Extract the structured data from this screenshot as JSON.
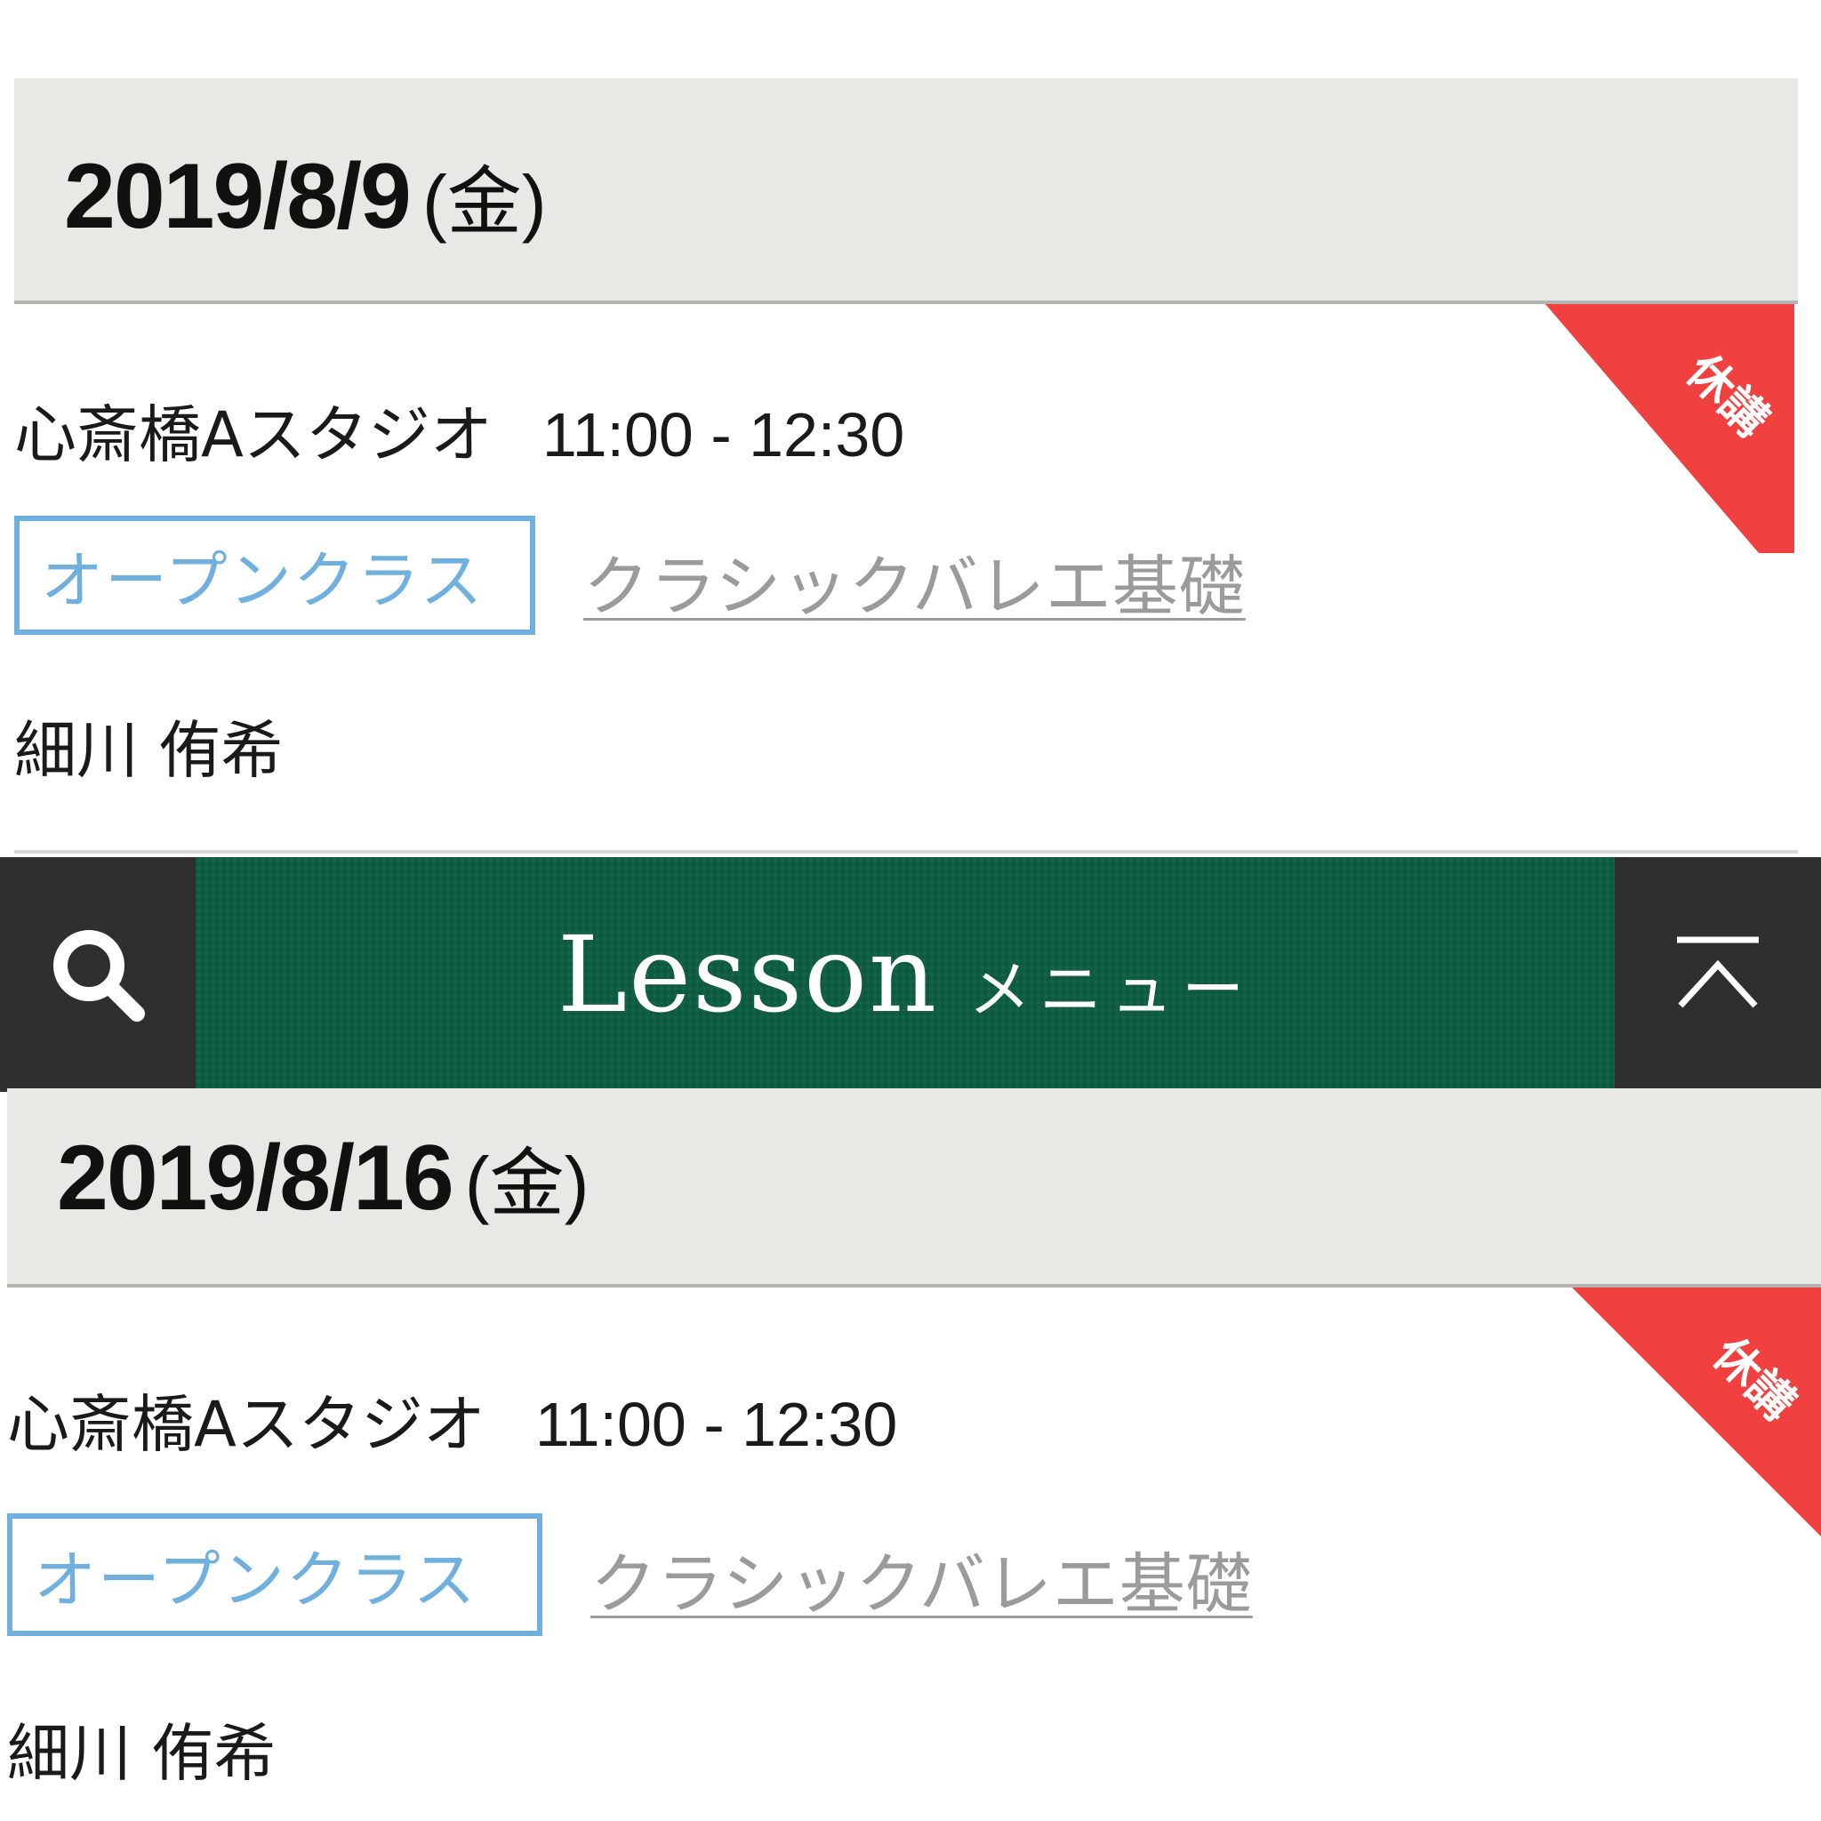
{
  "lessons": [
    {
      "date": "2019/8/9",
      "weekday": "(金)",
      "studio": "心斎橋Aスタジオ",
      "time": "11:00 - 12:30",
      "badge": "オープンクラス",
      "class_name": "クラシックバレエ基礎",
      "instructor": "細川 侑希",
      "status": "休講"
    },
    {
      "date": "2019/8/16",
      "weekday": "(金)",
      "studio": "心斎橋Aスタジオ",
      "time": "11:00 - 12:30",
      "badge": "オープンクラス",
      "class_name": "クラシックバレエ基礎",
      "instructor": "細川 侑希",
      "status": "休講"
    }
  ],
  "menu": {
    "title_en": "Lesson",
    "title_jp": "メニュー",
    "left_icon": "search-icon",
    "right_icon": "back-to-top-icon"
  },
  "colors": {
    "header_bg": "#e8e8e5",
    "badge": "#6fb0de",
    "ribbon": "#f04040",
    "menu_green": "#0f5e43",
    "menu_dark": "#2f2f2f",
    "link_gray": "#9b9b9b"
  }
}
